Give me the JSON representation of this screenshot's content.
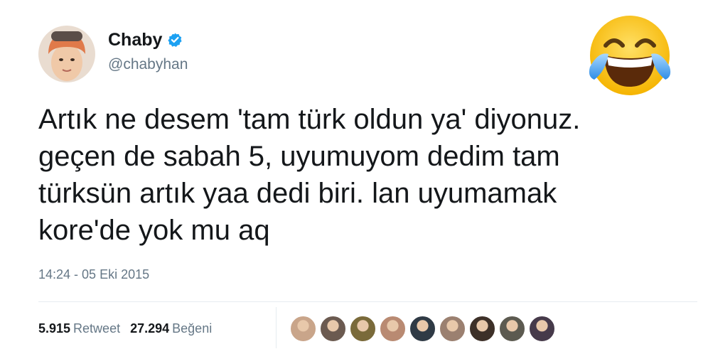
{
  "author": {
    "display_name": "Chaby",
    "handle": "@chabyhan",
    "verified": true
  },
  "tweet": {
    "lines": [
      "Artık ne desem 'tam türk oldun ya' diyonuz.",
      "geçen de sabah 5, uyumuyom dedim tam",
      "türksün artık yaa dedi biri. lan uyumamak",
      "kore'de yok mu aq"
    ],
    "timestamp": "14:24 - 05 Eki 2015"
  },
  "stats": {
    "retweets": {
      "count": "5.915",
      "label": "Retweet"
    },
    "likes": {
      "count": "27.294",
      "label": "Beğeni"
    }
  },
  "liker_avatars": [
    {
      "color": "#c9a58a"
    },
    {
      "color": "#6b5a50"
    },
    {
      "color": "#7a6a3a"
    },
    {
      "color": "#b98a72"
    },
    {
      "color": "#2f3a45"
    },
    {
      "color": "#9b8070"
    },
    {
      "color": "#3d3028"
    },
    {
      "color": "#5c5a50"
    },
    {
      "color": "#463a4a"
    }
  ],
  "decorative_emoji": "tears-of-joy-emoji",
  "colors": {
    "text": "#14171a",
    "muted": "#657786",
    "verified": "#1da1f2",
    "divider": "#e6ecf0"
  }
}
